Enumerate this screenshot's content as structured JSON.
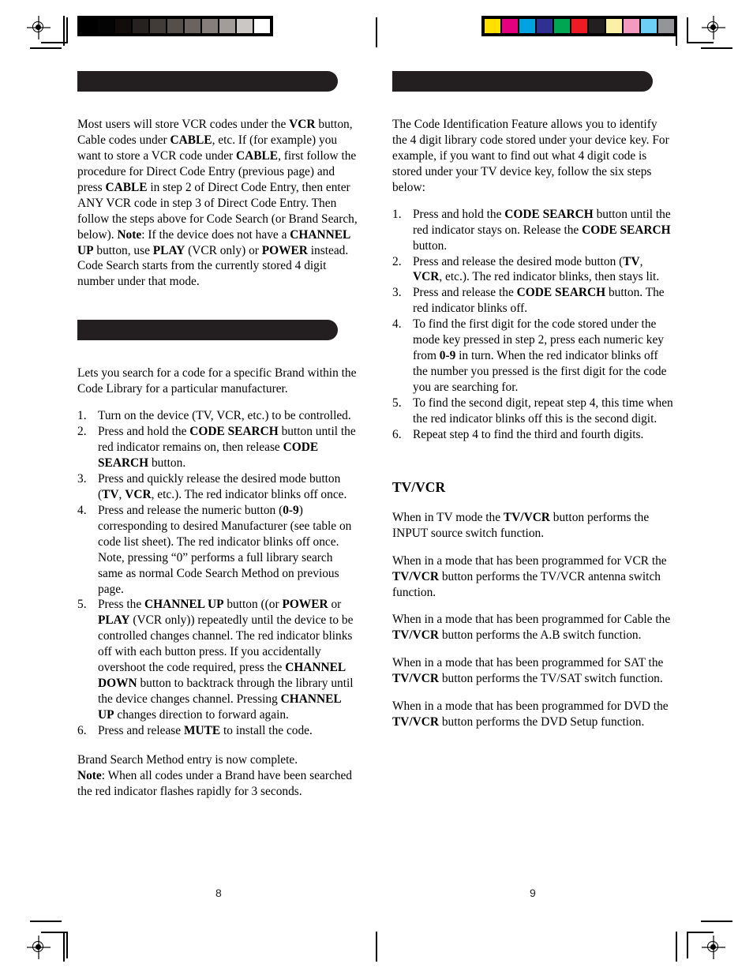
{
  "document": {
    "type": "universal-remote-instruction-manual-spread",
    "page_numbers": {
      "left": "8",
      "right": "9"
    }
  },
  "calibration": {
    "grayscale_swatches": [
      "#000000",
      "#050404",
      "#120d0b",
      "#262220",
      "#423c38",
      "#564e49",
      "#6b6360",
      "#857e7b",
      "#a39d99",
      "#cbc7c4",
      "#ffffff"
    ],
    "color_swatches": [
      "#ffe000",
      "#e5007d",
      "#00a3e0",
      "#2e3192",
      "#00a651",
      "#ed1c24",
      "#231f20",
      "#fbf0a5",
      "#f49ac1",
      "#6dcff6",
      "#939598"
    ]
  },
  "left_column": {
    "section_one": {
      "header_bar": "",
      "paragraphs": [
        {
          "runs": [
            {
              "text": "Most users will store VCR codes under the ",
              "bold": false
            },
            {
              "text": "VCR",
              "bold": true
            },
            {
              "text": " button, Cable codes under ",
              "bold": false
            },
            {
              "text": "CABLE",
              "bold": true
            },
            {
              "text": ", etc. If (for example) you want to store a VCR code under ",
              "bold": false
            },
            {
              "text": "CABLE",
              "bold": true
            },
            {
              "text": ", first follow the procedure for Direct Code Entry (previous page) and press ",
              "bold": false
            },
            {
              "text": "CABLE",
              "bold": true
            },
            {
              "text": " in step 2 of Direct Code Entry, then enter ANY VCR code in step 3 of Direct Code Entry. Then follow the steps above for Code Search (or Brand Search, below). ",
              "bold": false
            },
            {
              "text": "Note",
              "bold": true
            },
            {
              "text": ":  If the device does not have a ",
              "bold": false
            },
            {
              "text": "CHANNEL UP",
              "bold": true
            },
            {
              "text": " button, use ",
              "bold": false
            },
            {
              "text": "PLAY",
              "bold": true
            },
            {
              "text": " (VCR only) or ",
              "bold": false
            },
            {
              "text": "POWER",
              "bold": true
            },
            {
              "text": " instead. Code Search starts from the currently stored 4 digit number under that mode.",
              "bold": false
            }
          ]
        }
      ]
    },
    "section_two": {
      "header_bar": "",
      "intro": {
        "runs": [
          {
            "text": "Lets you search for a code for a specific Brand within the Code Library for a particular manufacturer.",
            "bold": false
          }
        ]
      },
      "steps": [
        {
          "number": "1.",
          "runs": [
            {
              "text": "Turn on the device (TV, VCR, etc.) to be controlled.",
              "bold": false
            }
          ]
        },
        {
          "number": "2.",
          "runs": [
            {
              "text": "Press and hold the ",
              "bold": false
            },
            {
              "text": "CODE SEARCH",
              "bold": true
            },
            {
              "text": " button until the red indicator remains on, then release ",
              "bold": false
            },
            {
              "text": "CODE SEARCH",
              "bold": true
            },
            {
              "text": " button.",
              "bold": false
            }
          ]
        },
        {
          "number": "3.",
          "runs": [
            {
              "text": "Press and quickly release the desired mode button (",
              "bold": false
            },
            {
              "text": "TV",
              "bold": true
            },
            {
              "text": ", ",
              "bold": false
            },
            {
              "text": "VCR",
              "bold": true
            },
            {
              "text": ", etc.). The red indicator blinks off once.",
              "bold": false
            }
          ]
        },
        {
          "number": "4.",
          "runs": [
            {
              "text": "Press and release the numeric button (",
              "bold": false
            },
            {
              "text": "0-9",
              "bold": true
            },
            {
              "text": ") corresponding to desired Manufacturer (see table on code list sheet).  The red indicator blinks off once. Note, pressing “0” performs a full library search same as normal Code Search Method on previous page.",
              "bold": false
            }
          ]
        },
        {
          "number": "5.",
          "runs": [
            {
              "text": "Press the ",
              "bold": false
            },
            {
              "text": "CHANNEL UP",
              "bold": true
            },
            {
              "text": " button ((or ",
              "bold": false
            },
            {
              "text": "POWER",
              "bold": true
            },
            {
              "text": " or ",
              "bold": false
            },
            {
              "text": "PLAY",
              "bold": true
            },
            {
              "text": " (VCR only)) repeatedly until the device to be controlled changes channel. The red indicator blinks off with each button press. If you accidentally overshoot the code required, press the ",
              "bold": false
            },
            {
              "text": "CHANNEL DOWN",
              "bold": true
            },
            {
              "text": " button to backtrack through the library until the device changes channel. Pressing ",
              "bold": false
            },
            {
              "text": "CHANNEL UP",
              "bold": true
            },
            {
              "text": " changes direction to forward again.",
              "bold": false
            }
          ]
        },
        {
          "number": "6.",
          "runs": [
            {
              "text": "Press and release ",
              "bold": false
            },
            {
              "text": "MUTE",
              "bold": true
            },
            {
              "text": " to install the code.",
              "bold": false
            }
          ]
        }
      ],
      "closing": {
        "runs": [
          {
            "text": "Brand Search Method entry is now complete.",
            "bold": false
          },
          {
            "text": "\n",
            "bold": false
          },
          {
            "text": "Note",
            "bold": true
          },
          {
            "text": ": When all codes under a Brand have been searched the red indicator flashes rapidly for 3 seconds.",
            "bold": false
          }
        ]
      }
    }
  },
  "right_column": {
    "section_one": {
      "header_bar": "",
      "intro": {
        "runs": [
          {
            "text": "The Code Identification Feature allows you to identify the 4 digit library code stored under your device key. For example, if you want to find out what 4 digit code is stored under your TV device key, follow the six steps below:",
            "bold": false
          }
        ]
      },
      "steps": [
        {
          "number": "1.",
          "runs": [
            {
              "text": "Press and hold the ",
              "bold": false
            },
            {
              "text": "CODE SEARCH",
              "bold": true
            },
            {
              "text": " button until the red indicator stays on. Release the ",
              "bold": false
            },
            {
              "text": "CODE SEARCH",
              "bold": true
            },
            {
              "text": " button.",
              "bold": false
            }
          ]
        },
        {
          "number": "2.",
          "runs": [
            {
              "text": "Press and release the desired mode button (",
              "bold": false
            },
            {
              "text": "TV",
              "bold": true
            },
            {
              "text": ", ",
              "bold": false
            },
            {
              "text": "VCR",
              "bold": true
            },
            {
              "text": ", etc.). The red indicator blinks, then stays lit.",
              "bold": false
            }
          ]
        },
        {
          "number": "3.",
          "runs": [
            {
              "text": "Press and release the ",
              "bold": false
            },
            {
              "text": "CODE SEARCH",
              "bold": true
            },
            {
              "text": " button. The red indicator blinks off.",
              "bold": false
            }
          ]
        },
        {
          "number": "4.",
          "runs": [
            {
              "text": "To find the first digit for the code stored under the mode key pressed in step 2, press each numeric key from ",
              "bold": false
            },
            {
              "text": "0-9",
              "bold": true
            },
            {
              "text": " in turn. When the red indicator blinks off the number you pressed is the first digit for the code you are searching for.",
              "bold": false
            }
          ]
        },
        {
          "number": "5.",
          "runs": [
            {
              "text": "To find the second digit, repeat step 4, this time when the red indicator blinks off this is the second digit.",
              "bold": false
            }
          ]
        },
        {
          "number": "6.",
          "runs": [
            {
              "text": "Repeat step 4 to find the third and fourth digits.",
              "bold": false
            }
          ]
        }
      ]
    },
    "section_two": {
      "heading": "TV/VCR",
      "paragraphs": [
        {
          "runs": [
            {
              "text": "When in TV mode the ",
              "bold": false
            },
            {
              "text": "TV/VCR",
              "bold": true
            },
            {
              "text": " button performs the INPUT source switch function.",
              "bold": false
            }
          ]
        },
        {
          "runs": [
            {
              "text": "When in a mode that has been programmed for VCR the ",
              "bold": false
            },
            {
              "text": "TV/VCR",
              "bold": true
            },
            {
              "text": " button performs the TV/VCR antenna switch function.",
              "bold": false
            }
          ]
        },
        {
          "runs": [
            {
              "text": "When in a mode that has been programmed for Cable the ",
              "bold": false
            },
            {
              "text": "TV/VCR",
              "bold": true
            },
            {
              "text": " button performs the A.B switch function.",
              "bold": false
            }
          ]
        },
        {
          "runs": [
            {
              "text": "When in a mode that has been programmed for SAT the ",
              "bold": false
            },
            {
              "text": "TV/VCR",
              "bold": true
            },
            {
              "text": " button performs the TV/SAT switch function.",
              "bold": false
            }
          ]
        },
        {
          "runs": [
            {
              "text": "When in a mode that has been programmed for DVD the ",
              "bold": false
            },
            {
              "text": "TV/VCR",
              "bold": true
            },
            {
              "text": " button performs the DVD Setup function.",
              "bold": false
            }
          ]
        }
      ]
    }
  }
}
